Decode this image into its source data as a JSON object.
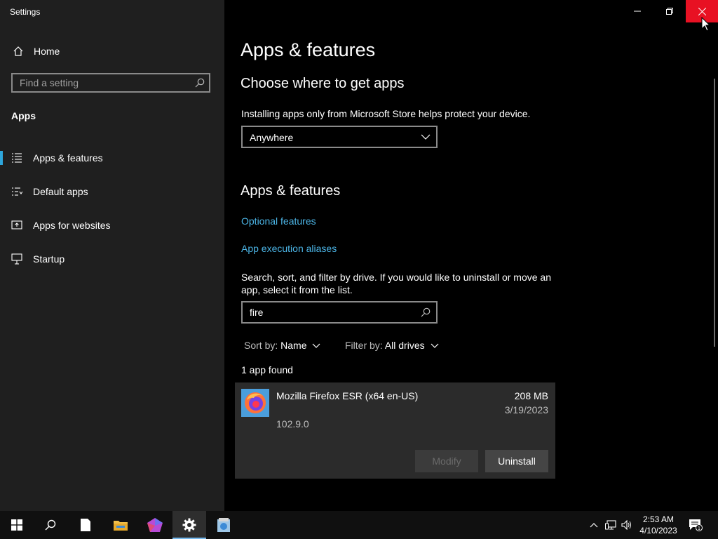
{
  "window": {
    "title": "Settings"
  },
  "sidebar": {
    "home_label": "Home",
    "search_placeholder": "Find a setting",
    "section": "Apps",
    "items": [
      {
        "label": "Apps & features",
        "icon": "apps-list-icon",
        "selected": true
      },
      {
        "label": "Default apps",
        "icon": "default-apps-icon",
        "selected": false
      },
      {
        "label": "Apps for websites",
        "icon": "apps-for-websites-icon",
        "selected": false
      },
      {
        "label": "Startup",
        "icon": "startup-icon",
        "selected": false
      }
    ]
  },
  "main": {
    "page_title": "Apps & features",
    "choose_heading": "Choose where to get apps",
    "choose_desc": "Installing apps only from Microsoft Store helps protect your device.",
    "source_selected": "Anywhere",
    "features_heading": "Apps & features",
    "links": [
      "Optional features",
      "App execution aliases"
    ],
    "search_desc": "Search, sort, and filter by drive. If you would like to uninstall or move an app, select it from the list.",
    "search_value": "fire",
    "sort_label": "Sort by:",
    "sort_value": "Name",
    "filter_label": "Filter by:",
    "filter_value": "All drives",
    "result_count": "1 app found",
    "apps": [
      {
        "name": "Mozilla Firefox ESR (x64 en-US)",
        "size": "208 MB",
        "date": "3/19/2023",
        "version": "102.9.0",
        "modify_label": "Modify",
        "uninstall_label": "Uninstall"
      }
    ]
  },
  "taskbar": {
    "time": "2:53 AM",
    "date": "4/10/2023",
    "notification_count": "1"
  },
  "colors": {
    "accent_link": "#4cb5e6",
    "selection_bar": "#2ea6db",
    "close_button": "#e81123"
  }
}
